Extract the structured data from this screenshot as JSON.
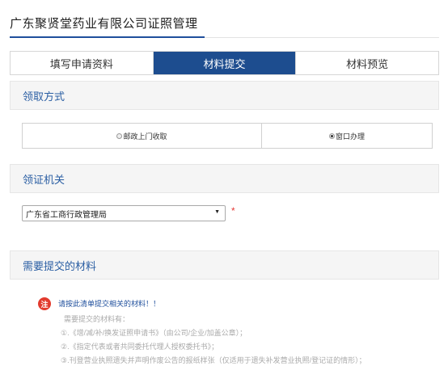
{
  "page": {
    "title": "广东聚贤堂药业有限公司证照管理"
  },
  "tabs": [
    {
      "label": "填写申请资料",
      "active": false
    },
    {
      "label": "材料提交",
      "active": true
    },
    {
      "label": "材料预览",
      "active": false
    }
  ],
  "pickup": {
    "heading": "领取方式",
    "options": [
      {
        "label": "邮政上门收取",
        "checked": false
      },
      {
        "label": "窗口办理",
        "checked": true
      }
    ]
  },
  "authority": {
    "heading": "领证机关",
    "selected": "广东省工商行政管理局",
    "required_mark": "*"
  },
  "materials": {
    "heading": "需要提交的材料",
    "notice_badge": "注",
    "notice": "请按此清单提交相关的材料！！",
    "intro": "需要提交的材料有：",
    "items": [
      "①.《增/减/补/换发证照申请书》（由公司/企业/加盖公章）；",
      "②.《指定代表或者共同委托代理人授权委托书》；",
      "③.刊登营业执照遗失并声明作废公告的报纸样张（仅适用于遗失补发营业执照/登记证的情形）；"
    ]
  },
  "colors": {
    "accent": "#1d4d8f",
    "link": "#2a5ea3",
    "required": "#e53935",
    "notice_badge": "#e23b2e"
  }
}
